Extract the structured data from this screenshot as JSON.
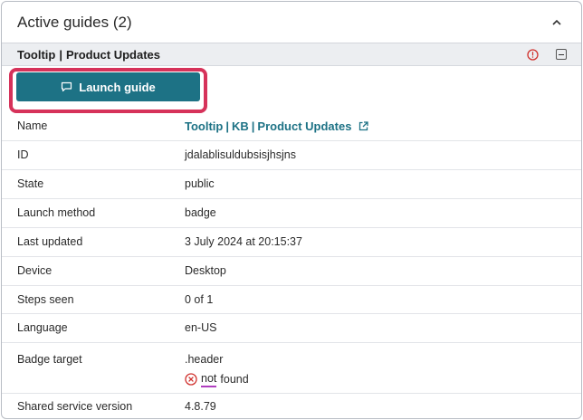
{
  "panel": {
    "title": "Active guides (2)",
    "collapse_icon": "chevron-up-icon"
  },
  "guide": {
    "title_type": "Tooltip",
    "title_sep": "|",
    "title_name": "Product Updates",
    "warning_icon": "warning-circle-icon",
    "collapse_icon": "minus-square-icon",
    "launch_label": "Launch guide",
    "launch_icon": "chat-bubble-icon"
  },
  "properties": {
    "name": {
      "label": "Name",
      "part1": "Tooltip",
      "sep1": "|",
      "part2": "KB",
      "sep2": "|",
      "part3": "Product Updates"
    },
    "id": {
      "label": "ID",
      "value": "jdalablisuldubsisjhsjns"
    },
    "state": {
      "label": "State",
      "value": "public"
    },
    "launch_method": {
      "label": "Launch method",
      "value": "badge"
    },
    "last_updated": {
      "label": "Last updated",
      "value": "3 July 2024 at 20:15:37"
    },
    "device": {
      "label": "Device",
      "value": "Desktop"
    },
    "steps_seen": {
      "label": "Steps seen",
      "value": "0 of 1"
    },
    "language": {
      "label": "Language",
      "value": "en-US"
    },
    "badge_target": {
      "label": "Badge target",
      "value": ".header",
      "status_word": "not",
      "status_rest": "found"
    },
    "shared_service_version": {
      "label": "Shared service version",
      "value": "4.8.79"
    }
  },
  "colors": {
    "accent": "#1d7285",
    "highlight": "#d6325a",
    "error": "#d0312d"
  }
}
